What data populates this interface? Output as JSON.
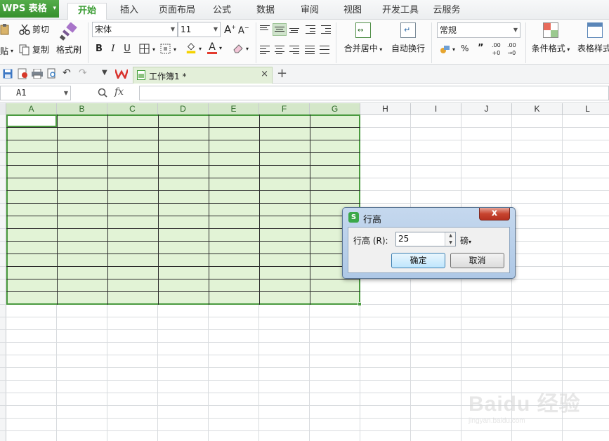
{
  "app": {
    "name": "WPS 表格",
    "menu_arrow": "▾"
  },
  "tabs": [
    {
      "label": "开始",
      "active": true
    },
    {
      "label": "插入"
    },
    {
      "label": "页面布局"
    },
    {
      "label": "公式"
    },
    {
      "label": "数据"
    },
    {
      "label": "审阅"
    },
    {
      "label": "视图"
    },
    {
      "label": "开发工具"
    },
    {
      "label": "云服务"
    }
  ],
  "ribbon": {
    "paste_label": "贴",
    "cut_label": "剪切",
    "copy_label": "复制",
    "format_painter_label": "格式刷",
    "font_name": "宋体",
    "font_size": "11",
    "bold": "B",
    "italic": "I",
    "underline": "U",
    "merge_center_label": "合并居中",
    "wrap_text_label": "自动换行",
    "number_format": "常规",
    "percent": "%",
    "comma": "”",
    "increase_decimal": ".00",
    "decrease_decimal": ".00",
    "conditional_format_label": "条件格式",
    "table_style_label": "表格样式",
    "font_color_accent": "#e33b2e",
    "fill_color_accent": "#f5d200"
  },
  "document": {
    "tab_title": "工作簿1 *",
    "close": "×",
    "new_tab": "+"
  },
  "formula_bar": {
    "cell_ref": "A1",
    "fx": "fx",
    "value": ""
  },
  "sheet": {
    "columns": [
      "A",
      "B",
      "C",
      "D",
      "E",
      "F",
      "G",
      "H",
      "I",
      "J",
      "K",
      "L"
    ],
    "selected_columns": [
      "A",
      "B",
      "C",
      "D",
      "E",
      "F",
      "G"
    ]
  },
  "dialog": {
    "title": "行高",
    "close": "x",
    "field_label": "行高 (R):",
    "field_value": "25",
    "unit": "磅",
    "ok_label": "确定",
    "cancel_label": "取消"
  },
  "watermark": {
    "main": "Baidu 经验",
    "sub": "jingyan.baidu.com"
  },
  "colors": {
    "accent_green": "#3a9c33",
    "selection_fill": "#e2f3d6",
    "selection_border": "#4a9a3f"
  }
}
